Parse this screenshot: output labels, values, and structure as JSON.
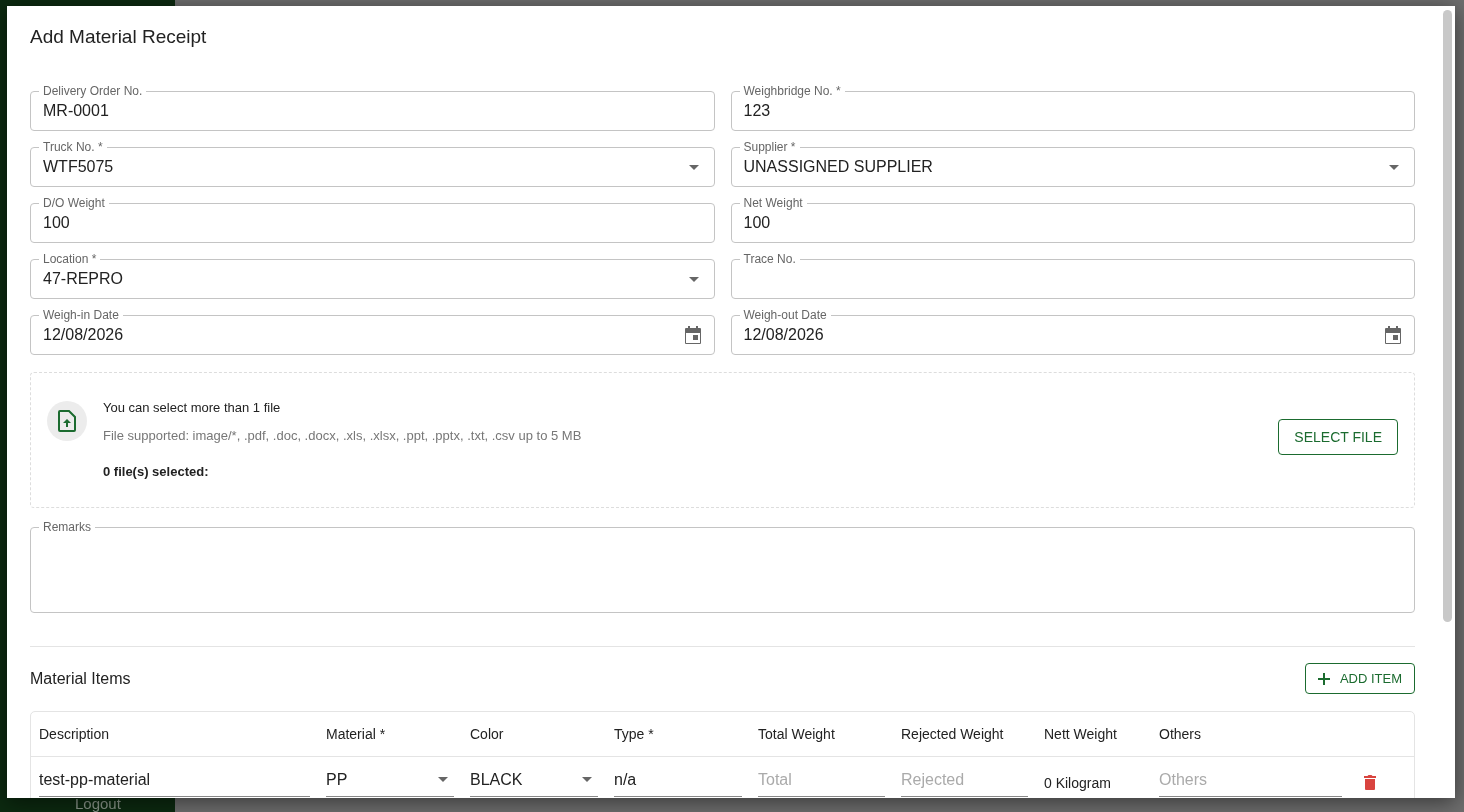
{
  "background": {
    "logout": "Logout"
  },
  "dialog": {
    "title": "Add Material Receipt"
  },
  "fields": [
    {
      "label": "Delivery Order No.",
      "value": "MR-0001",
      "kind": "text"
    },
    {
      "label": "Weighbridge No. *",
      "value": "123",
      "kind": "text"
    },
    {
      "label": "Truck No. *",
      "value": "WTF5075",
      "kind": "select"
    },
    {
      "label": "Supplier *",
      "value": "UNASSIGNED SUPPLIER",
      "kind": "select"
    },
    {
      "label": "D/O Weight",
      "value": "100",
      "kind": "text"
    },
    {
      "label": "Net Weight",
      "value": "100",
      "kind": "text"
    },
    {
      "label": "Location *",
      "value": "47-REPRO",
      "kind": "select"
    },
    {
      "label": "Trace No.",
      "kind": "text"
    },
    {
      "label": "Weigh-in Date",
      "value": "12/08/2026",
      "kind": "date"
    },
    {
      "label": "Weigh-out Date",
      "value": "12/08/2026",
      "kind": "date"
    }
  ],
  "upload": {
    "hint": "You can select more than 1 file",
    "supported": "File supported: image/*, .pdf, .doc, .docx, .xls, .xlsx, .ppt, .pptx, .txt, .csv up to 5 MB",
    "count": "0 file(s) selected:",
    "button": "SELECT FILE"
  },
  "remarks": {
    "label": "Remarks"
  },
  "items_section": {
    "title": "Material Items",
    "add_button": "ADD ITEM"
  },
  "table": {
    "columns": [
      "Description",
      "Material *",
      "Color",
      "Type *",
      "Total Weight",
      "Rejected Weight",
      "Nett Weight",
      "Others"
    ],
    "rows": [
      {
        "cells": [
          {
            "kind": "input",
            "value": "test-pp-material"
          },
          {
            "kind": "select",
            "value": "PP"
          },
          {
            "kind": "select",
            "value": "BLACK"
          },
          {
            "kind": "input",
            "value": "n/a"
          },
          {
            "kind": "input",
            "placeholder": "Total"
          },
          {
            "kind": "input",
            "placeholder": "Rejected"
          },
          {
            "kind": "text",
            "value": "0 Kilogram"
          },
          {
            "kind": "input",
            "placeholder": "Others"
          }
        ]
      }
    ]
  }
}
